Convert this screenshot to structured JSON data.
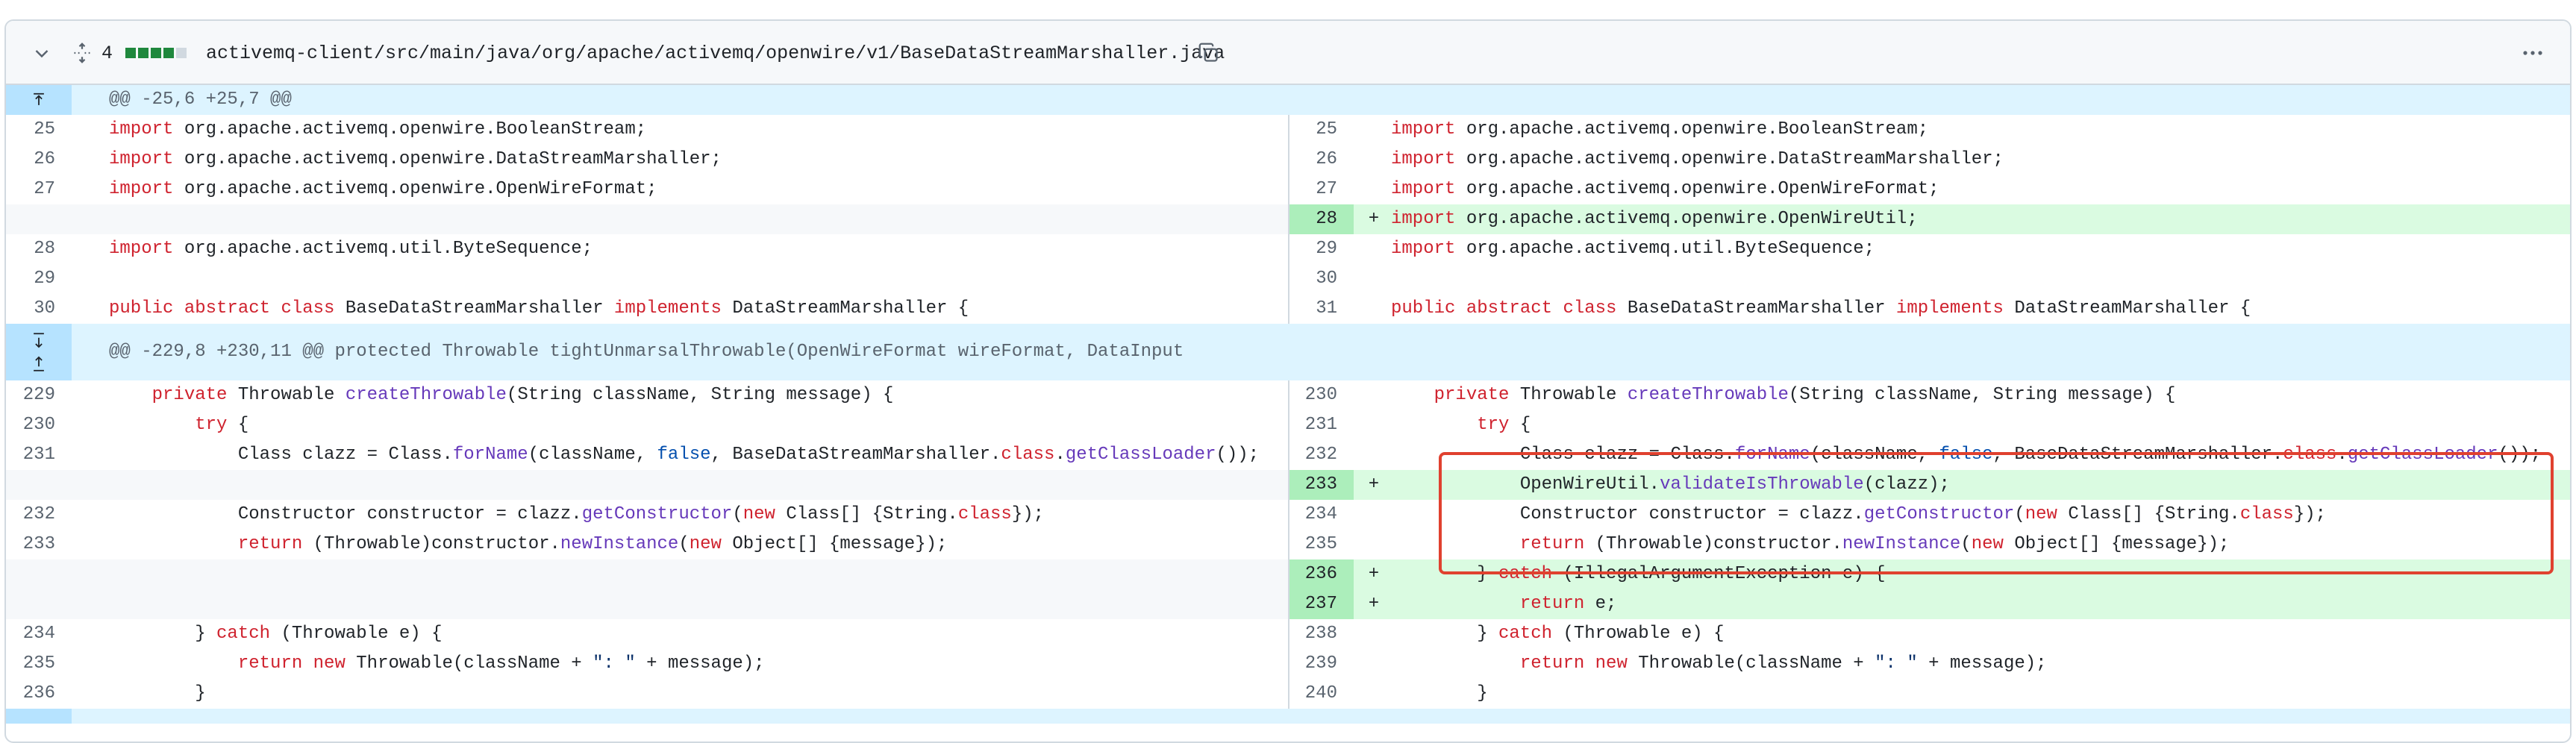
{
  "file": {
    "changes_count": "4",
    "path": "activemq-client/src/main/java/org/apache/activemq/openwire/v1/BaseDataStreamMarshaller.java",
    "diffstat_colors": [
      "#1f883d",
      "#1f883d",
      "#1f883d",
      "#1f883d",
      "#d1d9e0"
    ],
    "icons": {
      "collapse": "chevron-down-icon",
      "expand": "unfold-icon",
      "copy": "copy-icon",
      "menu": "kebab-horizontal-icon"
    }
  },
  "colors": {
    "addition_bg": "#dafbe1",
    "addition_num_bg": "#aceebb",
    "hunk_bg": "#ddf4ff",
    "highlight": "#e0412f"
  },
  "hunks": [
    {
      "header": "@@ -25,6 +25,7 @@"
    },
    {
      "header": "@@ -229,8 +230,11 @@ protected Throwable tightUnmarsalThrowable(OpenWireFormat wireFormat, DataInput"
    }
  ],
  "rows": [
    {
      "ln_l": "25",
      "ln_r": "25",
      "code_l": "import org.apache.activemq.openwire.BooleanStream;",
      "code_r": "import org.apache.activemq.openwire.BooleanStream;"
    },
    {
      "ln_l": "26",
      "ln_r": "26",
      "code_l": "import org.apache.activemq.openwire.DataStreamMarshaller;",
      "code_r": "import org.apache.activemq.openwire.DataStreamMarshaller;"
    },
    {
      "ln_l": "27",
      "ln_r": "27",
      "code_l": "import org.apache.activemq.openwire.OpenWireFormat;",
      "code_r": "import org.apache.activemq.openwire.OpenWireFormat;"
    },
    {
      "ln_l": "",
      "ln_r": "28",
      "marker": "+",
      "code_l": "",
      "code_r": "import org.apache.activemq.openwire.OpenWireUtil;"
    },
    {
      "ln_l": "28",
      "ln_r": "29",
      "code_l": "import org.apache.activemq.util.ByteSequence;",
      "code_r": "import org.apache.activemq.util.ByteSequence;"
    },
    {
      "ln_l": "29",
      "ln_r": "30",
      "code_l": "",
      "code_r": ""
    },
    {
      "ln_l": "30",
      "ln_r": "31",
      "code_l": "public abstract class BaseDataStreamMarshaller implements DataStreamMarshaller {",
      "code_r": "public abstract class BaseDataStreamMarshaller implements DataStreamMarshaller {"
    },
    {
      "ln_l": "229",
      "ln_r": "230",
      "code_l": "    private Throwable createThrowable(String className, String message) {",
      "code_r": "    private Throwable createThrowable(String className, String message) {"
    },
    {
      "ln_l": "230",
      "ln_r": "231",
      "code_l": "        try {",
      "code_r": "        try {"
    },
    {
      "ln_l": "231",
      "ln_r": "232",
      "code_l": "            Class clazz = Class.forName(className, false, BaseDataStreamMarshaller.class.getClassLoader());",
      "code_r": "            Class clazz = Class.forName(className, false, BaseDataStreamMarshaller.class.getClassLoader());"
    },
    {
      "ln_l": "",
      "ln_r": "233",
      "marker": "+",
      "code_l": "",
      "code_r": "            OpenWireUtil.validateIsThrowable(clazz);"
    },
    {
      "ln_l": "232",
      "ln_r": "234",
      "code_l": "            Constructor constructor = clazz.getConstructor(new Class[] {String.class});",
      "code_r": "            Constructor constructor = clazz.getConstructor(new Class[] {String.class});"
    },
    {
      "ln_l": "233",
      "ln_r": "235",
      "code_l": "            return (Throwable)constructor.newInstance(new Object[] {message});",
      "code_r": "            return (Throwable)constructor.newInstance(new Object[] {message});"
    },
    {
      "ln_l": "",
      "ln_r": "236",
      "marker": "+",
      "code_l": "",
      "code_r": "        } catch (IllegalArgumentException e) {"
    },
    {
      "ln_l": "",
      "ln_r": "237",
      "marker": "+",
      "code_l": "",
      "code_r": "            return e;"
    },
    {
      "ln_l": "234",
      "ln_r": "238",
      "code_l": "        } catch (Throwable e) {",
      "code_r": "        } catch (Throwable e) {"
    },
    {
      "ln_l": "235",
      "ln_r": "239",
      "code_l": "            return new Throwable(className + \": \" + message);",
      "code_r": "            return new Throwable(className + \": \" + message);"
    },
    {
      "ln_l": "236",
      "ln_r": "240",
      "code_l": "        }",
      "code_r": "        }"
    }
  ]
}
